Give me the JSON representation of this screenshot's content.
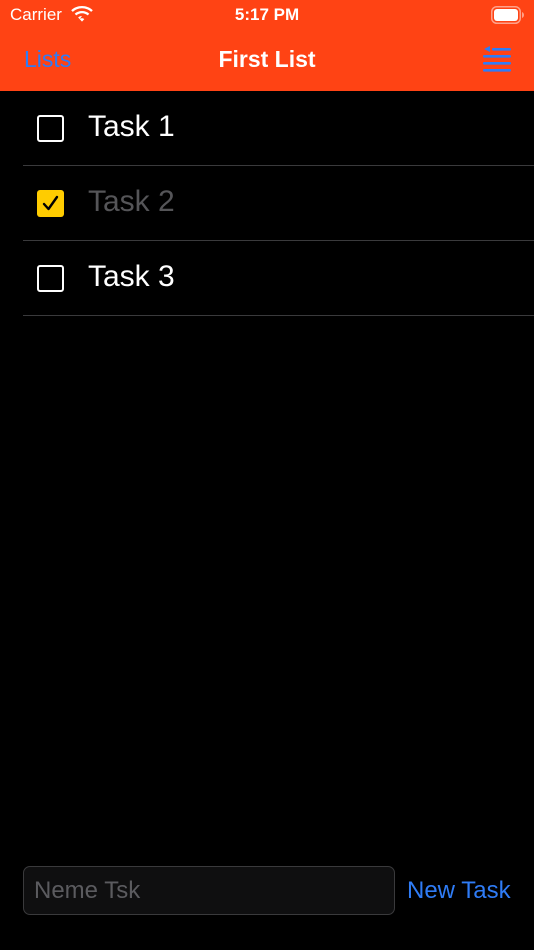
{
  "status_bar": {
    "carrier": "Carrier",
    "time": "5:17 PM",
    "icons": [
      "wifi-icon",
      "battery-icon"
    ]
  },
  "nav_bar": {
    "back_label": "Lists",
    "title": "First List",
    "sort_icon": "sort-lines-icon"
  },
  "tasks": [
    {
      "label": "Task 1",
      "checked": false
    },
    {
      "label": "Task 2",
      "checked": true
    },
    {
      "label": "Task 3",
      "checked": false
    }
  ],
  "composer": {
    "placeholder": "Neme Tsk",
    "value": "",
    "button_label": "New Task"
  },
  "colors": {
    "header_bg": "#FF4314",
    "link_blue": "#2F7CF6",
    "checkbox_checked": "#FFCC00",
    "background": "#000000"
  }
}
